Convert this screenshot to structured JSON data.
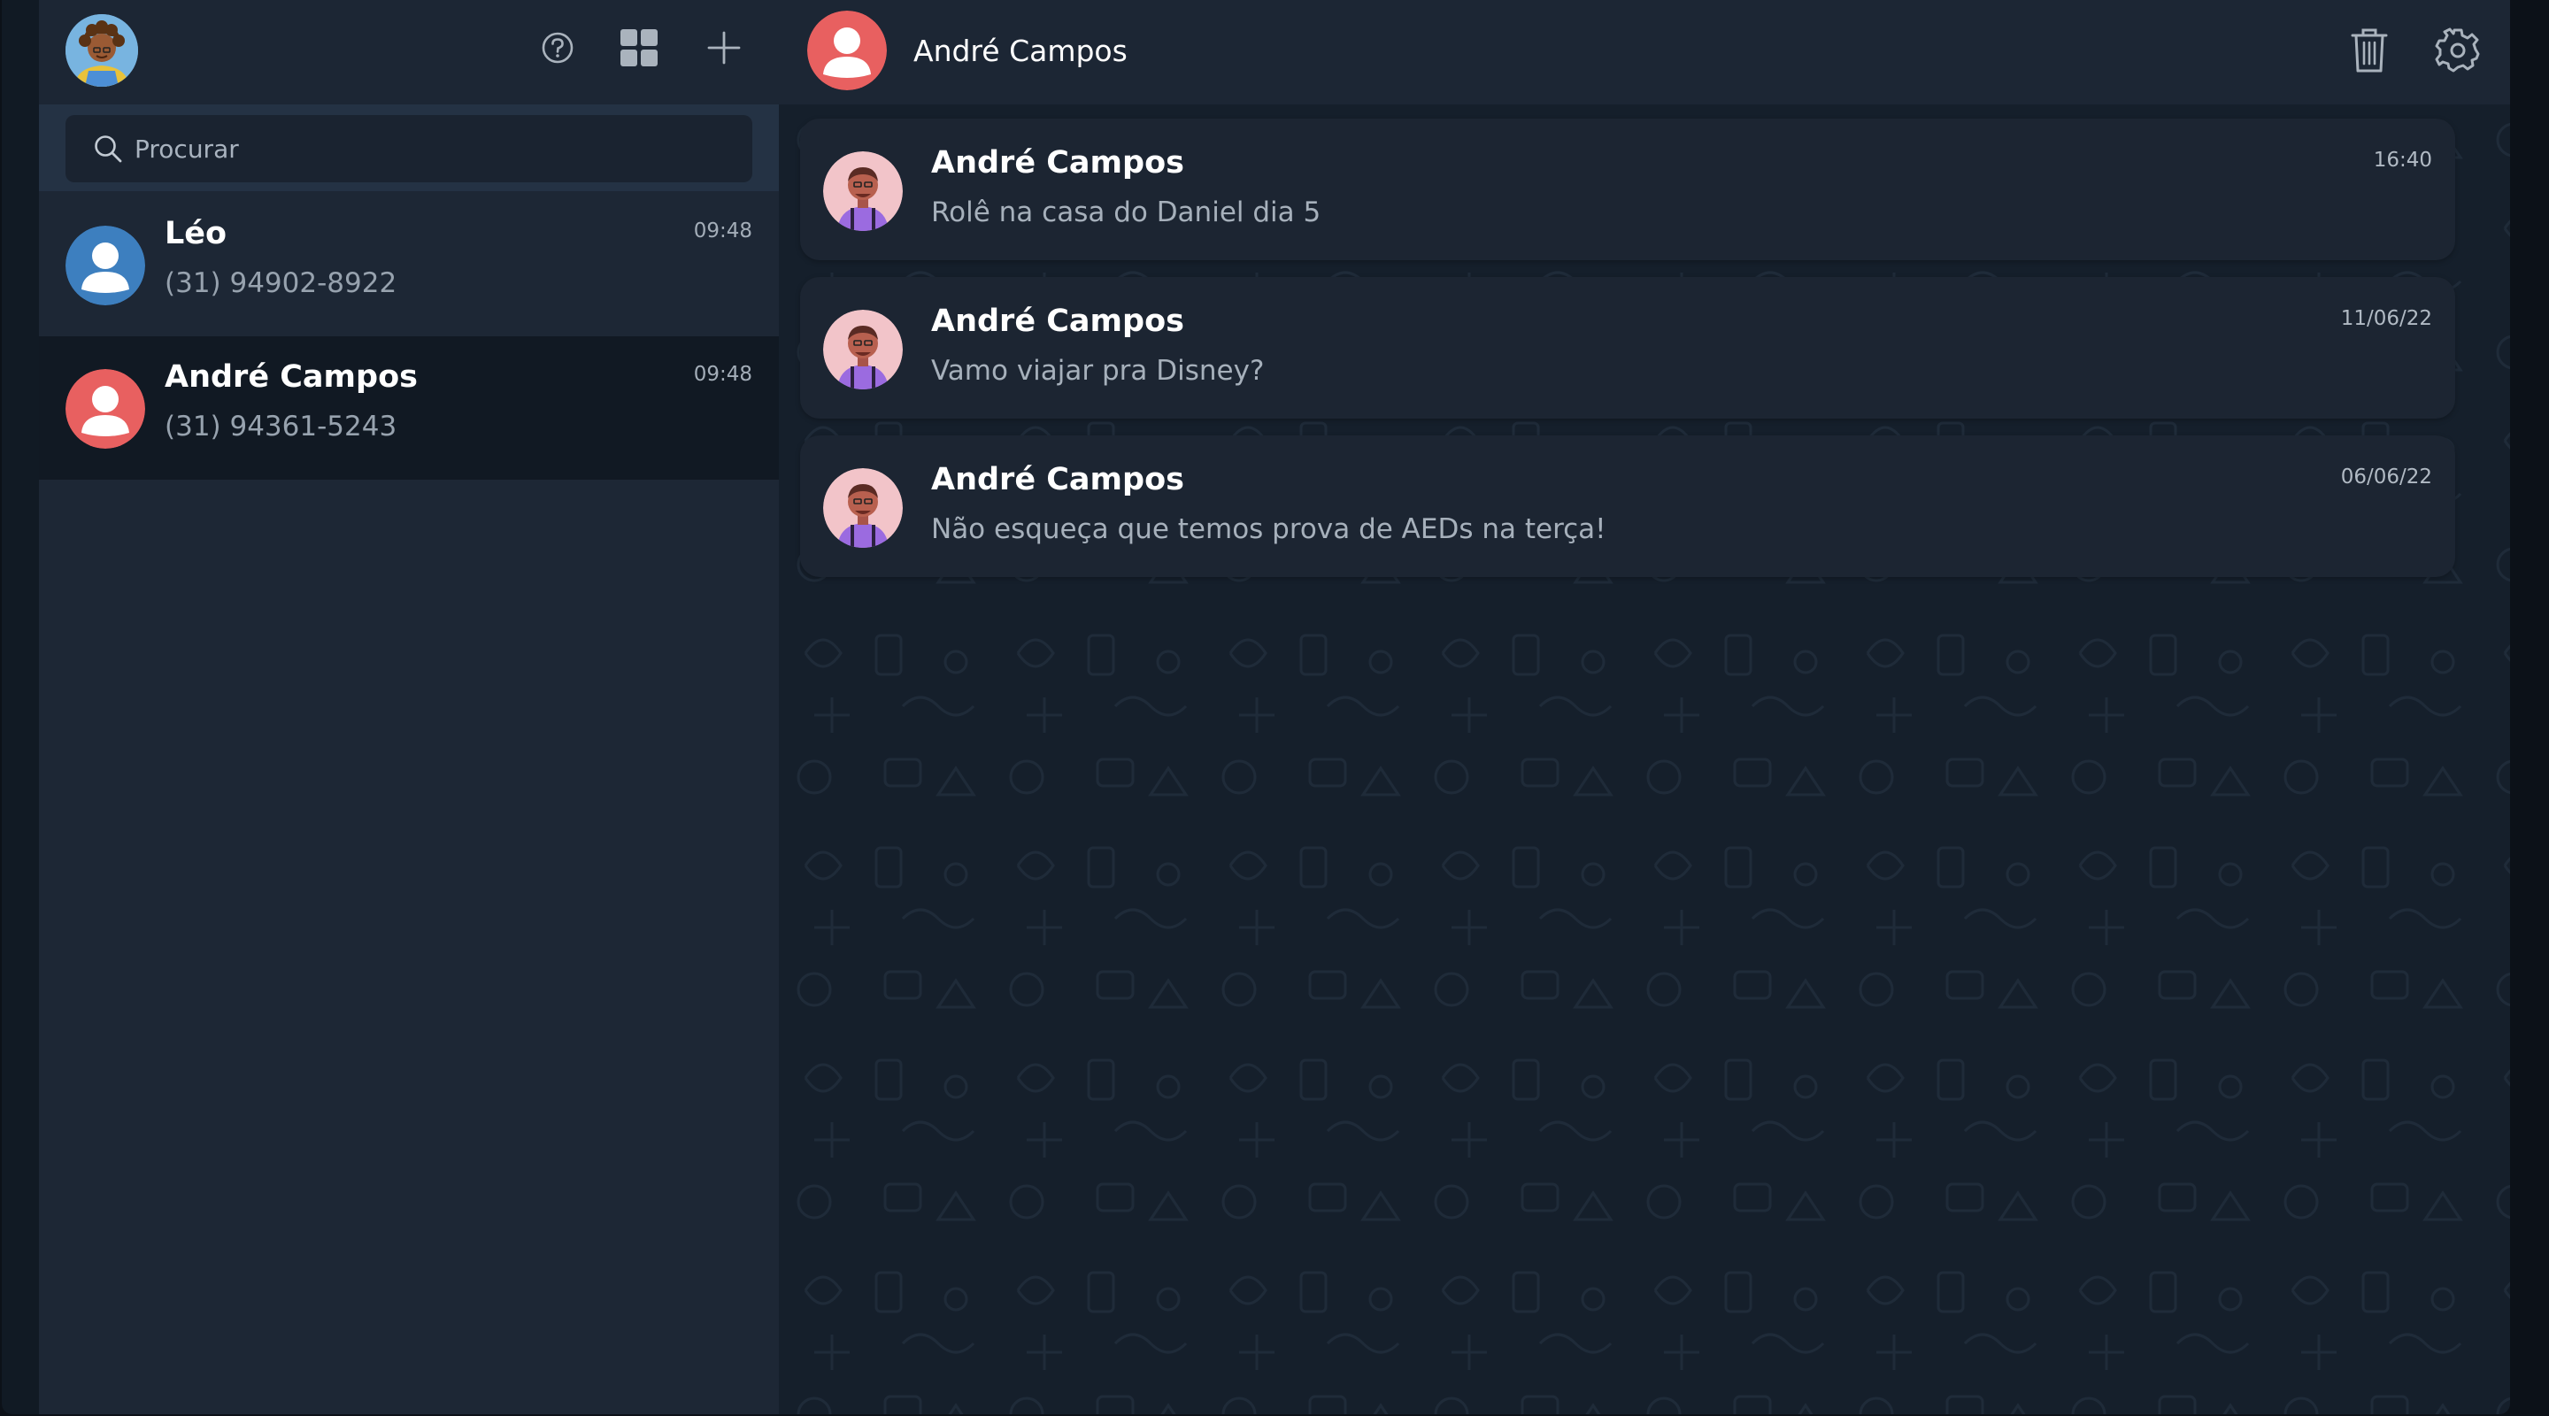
{
  "colors": {
    "sidebar_bg": "#1d2735",
    "header_bg": "#1c2634",
    "active_contact_bg": "#111923",
    "chat_bg": "#151f2b",
    "message_card_bg": "#1c2532",
    "avatar_blue": "#3d7fbf",
    "avatar_red": "#e86060",
    "icon_gray": "#aab3bd"
  },
  "sidebar": {
    "header_icons": [
      "help-icon",
      "grid-icon",
      "plus-icon"
    ],
    "search": {
      "placeholder": "Procurar",
      "value": ""
    },
    "contacts": [
      {
        "name": "Léo",
        "phone": "(31) 94902-8922",
        "time": "09:48",
        "avatar": "user-icon",
        "avatar_color": "#3d7fbf",
        "active": false
      },
      {
        "name": "André Campos",
        "phone": "(31) 94361-5243",
        "time": "09:48",
        "avatar": "user-icon",
        "avatar_color": "#e86060",
        "active": true
      }
    ]
  },
  "chat": {
    "title": "André Campos",
    "header_actions": [
      "trash-icon",
      "gear-icon"
    ],
    "messages": [
      {
        "sender": "André Campos",
        "text": "Rolê na casa do Daniel dia 5",
        "time": "16:40"
      },
      {
        "sender": "André Campos",
        "text": "Vamo viajar pra Disney?",
        "time": "11/06/22"
      },
      {
        "sender": "André Campos",
        "text": "Não esqueça que temos prova de AEDs na terça!",
        "time": "06/06/22"
      }
    ]
  }
}
